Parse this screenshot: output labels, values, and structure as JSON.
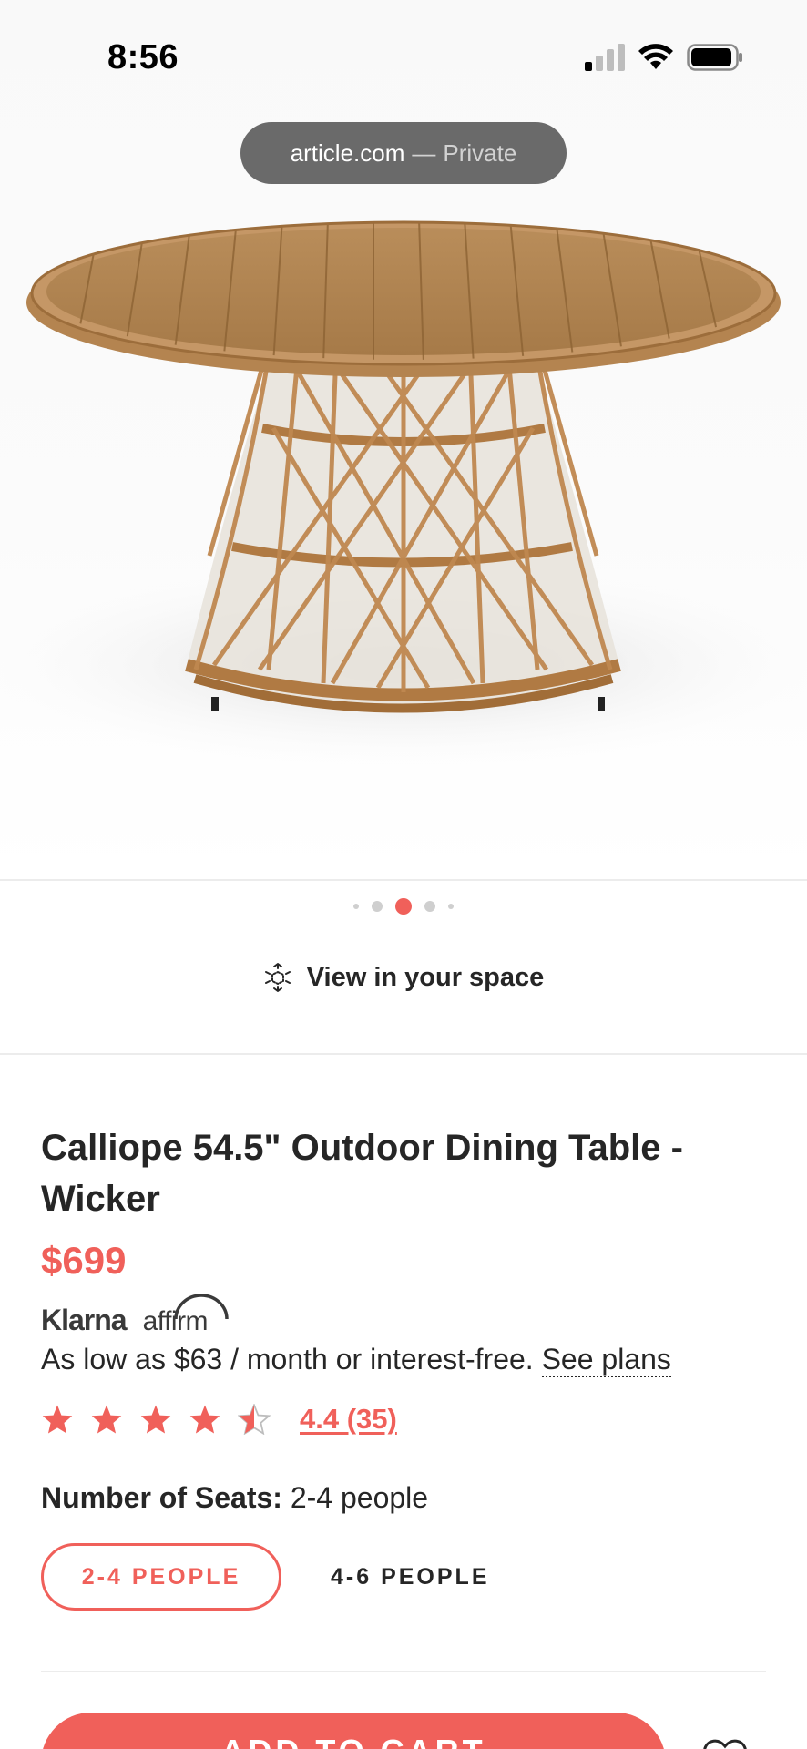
{
  "status_bar": {
    "time": "8:56"
  },
  "browser": {
    "domain": "article.com",
    "separator": "—",
    "mode": "Private"
  },
  "carousel": {
    "total": 5,
    "active_index": 2
  },
  "view_in_space": {
    "label": "View in your space"
  },
  "product": {
    "title": "Calliope 54.5\" Outdoor Dining Table - Wicker",
    "price": "$699"
  },
  "financing": {
    "providers": [
      "Klarna",
      "affirm"
    ],
    "text": "As low as $63 / month or interest-free.",
    "link": "See plans"
  },
  "rating": {
    "stars": 4.4,
    "label": "4.4 (35)"
  },
  "seats": {
    "label": "Number of Seats:",
    "value": "2-4 people",
    "options": [
      {
        "label": "2-4 PEOPLE",
        "selected": true
      },
      {
        "label": "4-6 PEOPLE",
        "selected": false
      }
    ]
  },
  "cta": {
    "add_to_cart": "ADD TO CART"
  },
  "colors": {
    "accent": "#f0605a",
    "text": "#262626"
  }
}
